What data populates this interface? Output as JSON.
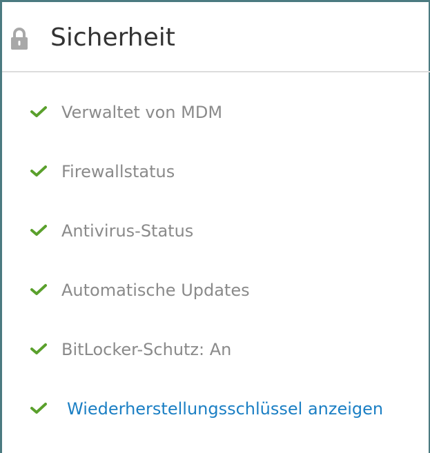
{
  "section": {
    "title": "Sicherheit",
    "icon": "lock-icon"
  },
  "items": [
    {
      "label": "Verwaltet von MDM",
      "status": "ok",
      "icon": "checkmark-icon"
    },
    {
      "label": "Firewallstatus",
      "status": "ok",
      "icon": "checkmark-icon"
    },
    {
      "label": "Antivirus-Status",
      "status": "ok",
      "icon": "checkmark-icon"
    },
    {
      "label": "Automatische Updates",
      "status": "ok",
      "icon": "checkmark-icon"
    },
    {
      "label": "BitLocker-Schutz: An",
      "status": "ok",
      "icon": "checkmark-icon"
    }
  ],
  "recovery_link": {
    "label": "Wiederherstellungsschlüssel anzeigen",
    "icon": "checkmark-icon"
  },
  "colors": {
    "frame": "#4b7a80",
    "check": "#5aa02c",
    "label": "#8a8a8a",
    "link": "#1b7fc4",
    "title": "#333333"
  }
}
